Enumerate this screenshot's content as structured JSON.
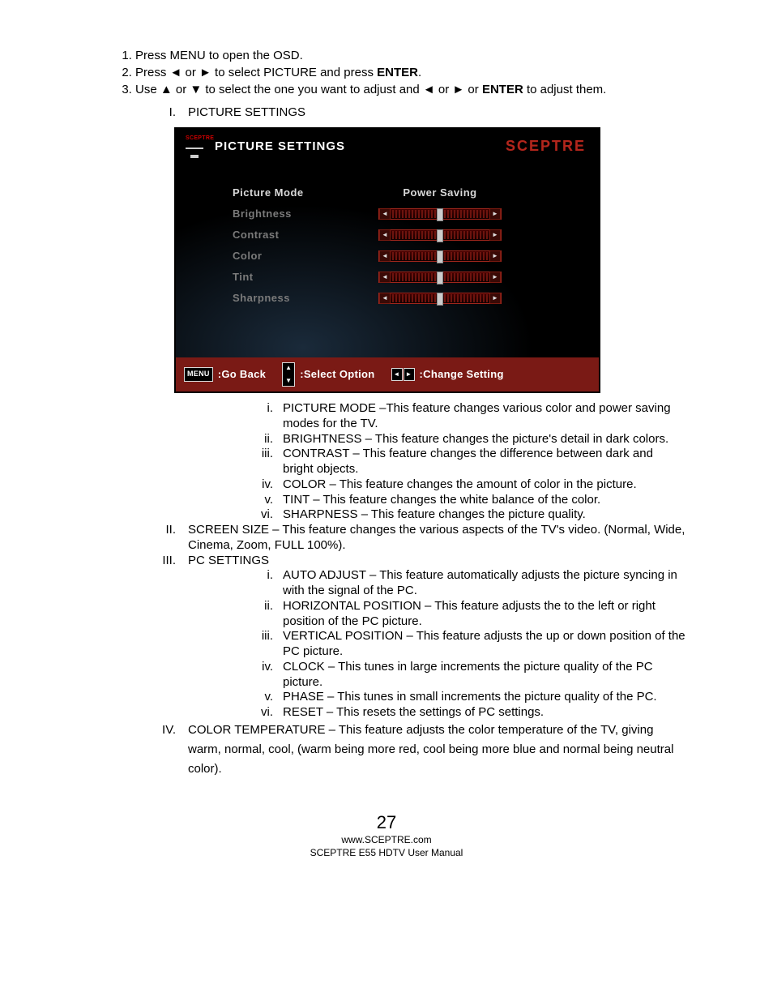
{
  "steps": {
    "s1": "Press MENU to open the OSD.",
    "s2_a": "Press ◄ or ► to select PICTURE and press ",
    "s2_b": "ENTER",
    "s2_c": ".",
    "s3_a": "Use ▲ or ▼ to select the one you want to adjust and ◄ or ► or ",
    "s3_b": "ENTER",
    "s3_c": " to adjust them."
  },
  "roman": {
    "I_num": "I.",
    "I": "PICTURE SETTINGS",
    "II_num": "II.",
    "II": "SCREEN SIZE – This feature changes the various aspects of the TV's video.  (Normal, Wide, Cinema, Zoom, FULL 100%).",
    "III_num": "III.",
    "III": "PC SETTINGS",
    "IV_num": "IV.",
    "IV": "COLOR TEMPERATURE – This feature adjusts the color temperature of the TV, giving warm, normal, cool, (warm being more red, cool being more blue and normal being neutral color)."
  },
  "osd": {
    "title": "PICTURE SETTINGS",
    "brand": "SCEPTRE",
    "picture_mode_label": "Picture Mode",
    "picture_mode_value": "Power Saving",
    "rows": {
      "brightness": "Brightness",
      "contrast": "Contrast",
      "color": "Color",
      "tint": "Tint",
      "sharpness": "Sharpness"
    },
    "footer": {
      "menu_key": "MENU",
      "go_back": ":Go Back",
      "select": ":Select Option",
      "change": ":Change Setting"
    }
  },
  "picture_sub": {
    "i_num": "i.",
    "i": "PICTURE MODE –This feature changes various color and power saving modes for the TV.",
    "ii_num": "ii.",
    "ii": "BRIGHTNESS – This feature changes the picture's detail in dark colors.",
    "iii_num": "iii.",
    "iii": "CONTRAST – This feature changes the difference between dark and bright objects.",
    "iv_num": "iv.",
    "iv": "COLOR – This feature changes the amount of color in the picture.",
    "v_num": "v.",
    "v": "TINT – This feature changes the white balance of the color.",
    "vi_num": "vi.",
    "vi": "SHARPNESS – This feature changes the picture quality."
  },
  "pc_sub": {
    "i_num": "i.",
    "i": "AUTO ADJUST – This feature automatically adjusts the picture syncing in with the signal of the PC.",
    "ii_num": "ii.",
    "ii": "HORIZONTAL POSITION – This feature adjusts the to the left or right position of the PC picture.",
    "iii_num": "iii.",
    "iii": "VERTICAL POSITION – This feature adjusts the up or down position of the PC picture.",
    "iv_num": "iv.",
    "iv": "CLOCK – This tunes in large increments the picture quality of the PC picture.",
    "v_num": "v.",
    "v": "PHASE – This tunes in small increments the picture quality of the PC.",
    "vi_num": "vi.",
    "vi": "RESET – This resets the settings of PC settings."
  },
  "footer": {
    "page": "27",
    "url": "www.SCEPTRE.com",
    "manual": "SCEPTRE E55 HDTV User Manual"
  }
}
